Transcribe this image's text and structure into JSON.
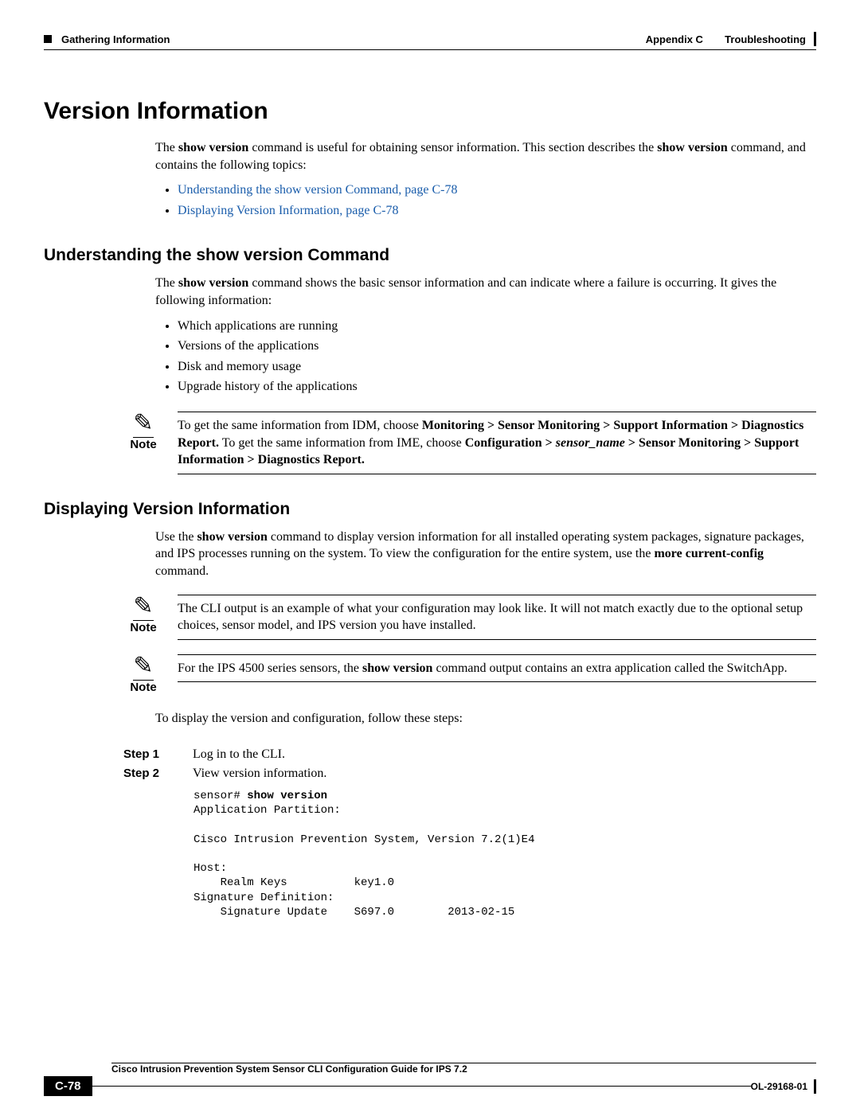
{
  "header": {
    "left_section": "Gathering Information",
    "right_appendix": "Appendix C",
    "right_title": "Troubleshooting"
  },
  "h1": "Version Information",
  "intro": {
    "part1": "The ",
    "bold1": "show version",
    "part2": " command is useful for obtaining sensor information. This section describes the ",
    "bold2": "show version",
    "part3": " command, and contains the following topics:"
  },
  "intro_links": [
    "Understanding the show version Command, page C-78",
    "Displaying Version Information, page C-78"
  ],
  "section1": {
    "title": "Understanding the show version Command",
    "para": {
      "p1": "The ",
      "b1": "show version",
      "p2": " command shows the basic sensor information and can indicate where a failure is occurring. It gives the following information:"
    },
    "bullets": [
      "Which applications are running",
      "Versions of the applications",
      "Disk and memory usage",
      "Upgrade history of the applications"
    ],
    "note": {
      "label": "Note",
      "p1": "To get the same information from IDM, choose ",
      "b1": "Monitoring > Sensor Monitoring > Support Information > Diagnostics Report.",
      "p2": " To get the same information from IME, choose ",
      "b2": "Configuration > ",
      "i1": "sensor_name",
      "b3": " > Sensor Monitoring > Support Information > Diagnostics Report."
    }
  },
  "section2": {
    "title": "Displaying Version Information",
    "para": {
      "p1": "Use the ",
      "b1": "show version",
      "p2": " command to display version information for all installed operating system packages, signature packages, and IPS processes running on the system. To view the configuration for the entire system, use the ",
      "b2": "more current-config",
      "p3": " command."
    },
    "note1": {
      "label": "Note",
      "text": "The CLI output is an example of what your configuration may look like. It will not match exactly due to the optional setup choices, sensor model, and IPS version you have installed."
    },
    "note2": {
      "label": "Note",
      "p1": "For the IPS 4500 series sensors, the ",
      "b1": "show version",
      "p2": " command output contains an extra application called the SwitchApp."
    },
    "steps_intro": "To display the version and configuration, follow these steps:",
    "steps": [
      {
        "label": "Step 1",
        "text": "Log in to the CLI."
      },
      {
        "label": "Step 2",
        "text": "View version information."
      }
    ],
    "code": {
      "prompt": "sensor# ",
      "cmd": "show version",
      "output": "Application Partition:\n\nCisco Intrusion Prevention System, Version 7.2(1)E4\n\nHost:\n    Realm Keys          key1.0\nSignature Definition:\n    Signature Update    S697.0        2013-02-15"
    }
  },
  "footer": {
    "guide_title": "Cisco Intrusion Prevention System Sensor CLI Configuration Guide for IPS 7.2",
    "page_number": "C-78",
    "doc_id": "OL-29168-01"
  }
}
